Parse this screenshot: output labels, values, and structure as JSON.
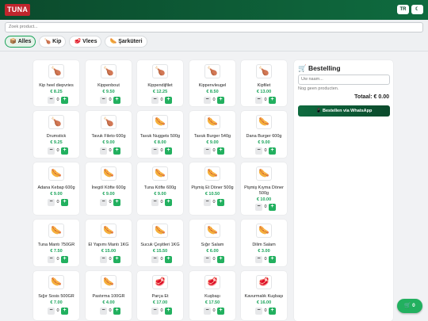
{
  "header": {
    "logo": "TUNA",
    "lang": "TR",
    "theme_icon": "moon-icon"
  },
  "search": {
    "placeholder": "Zoek product..."
  },
  "tabs": [
    {
      "icon": "📦",
      "label": "Alles",
      "active": true
    },
    {
      "icon": "🍗",
      "label": "Kip"
    },
    {
      "icon": "🥩",
      "label": "Vlees"
    },
    {
      "icon": "🌭",
      "label": "Şarküteri"
    }
  ],
  "products": [
    {
      "icon": "🍗",
      "name": "Kip heel diepvries",
      "price": "€ 8.25",
      "qty": "0"
    },
    {
      "icon": "🍗",
      "name": "Kippenbout",
      "price": "€ 9.50",
      "qty": "0"
    },
    {
      "icon": "🍗",
      "name": "Kippendijfilet",
      "price": "€ 12.25",
      "qty": "0"
    },
    {
      "icon": "🍗",
      "name": "Kippenvleugel",
      "price": "€ 8.50",
      "qty": "0"
    },
    {
      "icon": "🍗",
      "name": "Kipfilet",
      "price": "€ 13.00",
      "qty": "0"
    },
    {
      "icon": "🍗",
      "name": "Drumstick",
      "price": "€ 9.25",
      "qty": "0"
    },
    {
      "icon": "🍗",
      "name": "Tavuk Fileto 600g",
      "price": "€ 9.00",
      "qty": "0"
    },
    {
      "icon": "🌭",
      "name": "Tavuk Nuggets 500g",
      "price": "€ 8.00",
      "qty": "0"
    },
    {
      "icon": "🌭",
      "name": "Tavuk Burger 540g",
      "price": "€ 9.00",
      "qty": "0"
    },
    {
      "icon": "🌭",
      "name": "Dana Burger 600g",
      "price": "€ 9.00",
      "qty": "0"
    },
    {
      "icon": "🌭",
      "name": "Adana Kebap 600g",
      "price": "€ 9.00",
      "qty": "0"
    },
    {
      "icon": "🌭",
      "name": "İnegöl Köfte 600g",
      "price": "€ 9.00",
      "qty": "0"
    },
    {
      "icon": "🌭",
      "name": "Tuna Köfte 600g",
      "price": "€ 9.00",
      "qty": "0"
    },
    {
      "icon": "🌭",
      "name": "Pişmiş Et Döner 500g",
      "price": "€ 10.50",
      "qty": "0"
    },
    {
      "icon": "🌭",
      "name": "Pişmiş Kıyma Döner 500g",
      "price": "€ 10.00",
      "qty": "0"
    },
    {
      "icon": "🌭",
      "name": "Tuna Mantı 750GR",
      "price": "€ 7.50",
      "qty": "0"
    },
    {
      "icon": "🌭",
      "name": "El Yapımı Mantı 1KG",
      "price": "€ 15.00",
      "qty": "0"
    },
    {
      "icon": "🌭",
      "name": "Sucuk Çeşitleri 1KG",
      "price": "€ 15.50",
      "qty": "0"
    },
    {
      "icon": "🌭",
      "name": "Sığır Salam",
      "price": "€ 6.00",
      "qty": "0"
    },
    {
      "icon": "🌭",
      "name": "Dilim Salam",
      "price": "€ 3.00",
      "qty": "0"
    },
    {
      "icon": "🌭",
      "name": "Sığır Sosis 500GR",
      "price": "€ 7.00",
      "qty": "0"
    },
    {
      "icon": "🌭",
      "name": "Pastırma 100GR",
      "price": "€ 4.00",
      "qty": "0"
    },
    {
      "icon": "🥩",
      "name": "Parça Et",
      "price": "€ 17.00",
      "qty": "0"
    },
    {
      "icon": "🥩",
      "name": "Kuşbaşı",
      "price": "€ 17.50",
      "qty": "0"
    },
    {
      "icon": "🥩",
      "name": "Kavurmalık Kuşbaşı",
      "price": "€ 16.00",
      "qty": "0"
    }
  ],
  "order": {
    "title": "🛒 Bestelling",
    "name_placeholder": "Uw naam...",
    "empty": "Nog geen producten.",
    "total": "Totaal: € 0.00",
    "whatsapp": "📱 Bestellen via WhatsApp"
  },
  "cart_fab": {
    "label": "🛒 0"
  },
  "colors": {
    "brand_green": "#0f6b3f",
    "accent_green": "#22b05f",
    "logo_red": "#c0262d"
  }
}
